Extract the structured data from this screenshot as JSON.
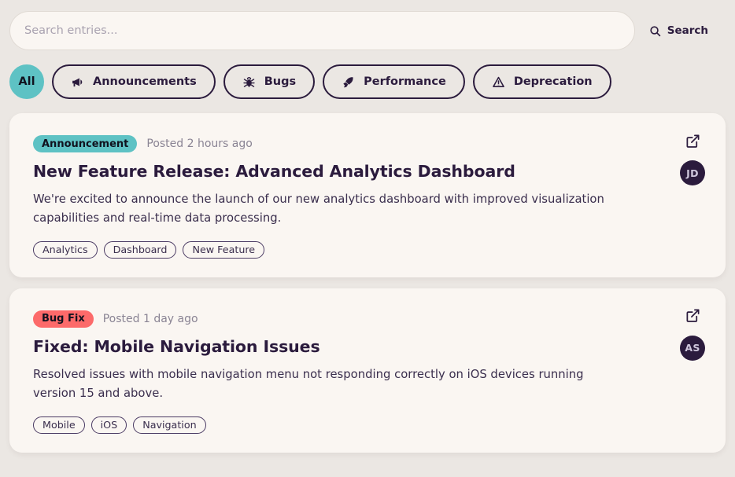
{
  "colors": {
    "page_bg": "#ebe7e3",
    "card_bg": "#faf6f2",
    "accent_teal": "#5ec2c4",
    "badge_bugfix": "#fc6a6a",
    "ink": "#2b1b3d",
    "muted": "#8a8494"
  },
  "search": {
    "placeholder": "Search entries...",
    "value": "",
    "button_label": "Search",
    "button_icon": "search-icon"
  },
  "filters": [
    {
      "label": "All",
      "icon": "",
      "active": true
    },
    {
      "label": "Announcements",
      "icon": "megaphone-icon",
      "active": false
    },
    {
      "label": "Bugs",
      "icon": "bug-icon",
      "active": false
    },
    {
      "label": "Performance",
      "icon": "rocket-icon",
      "active": false
    },
    {
      "label": "Deprecation",
      "icon": "warning-triangle-icon",
      "active": false
    }
  ],
  "entries": [
    {
      "badge": "Announcement",
      "badge_color": "#5ec2c4",
      "posted": "Posted 2 hours ago",
      "title": "New Feature Release: Advanced Analytics Dashboard",
      "body": "We're excited to announce the launch of our new analytics dashboard with improved visualization capabilities and real-time data processing.",
      "tags": [
        "Analytics",
        "Dashboard",
        "New Feature"
      ],
      "avatar_initials": "JD",
      "link_icon": "external-link-icon"
    },
    {
      "badge": "Bug Fix",
      "badge_color": "#fc6a6a",
      "posted": "Posted 1 day ago",
      "title": "Fixed: Mobile Navigation Issues",
      "body": "Resolved issues with mobile navigation menu not responding correctly on iOS devices running version 15 and above.",
      "tags": [
        "Mobile",
        "iOS",
        "Navigation"
      ],
      "avatar_initials": "AS",
      "link_icon": "external-link-icon"
    }
  ]
}
